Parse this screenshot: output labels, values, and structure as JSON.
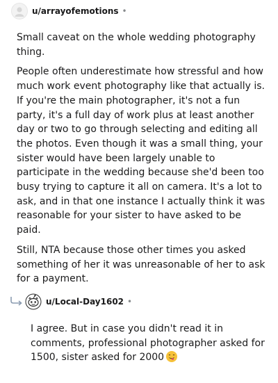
{
  "comments": [
    {
      "username": "u/arrayofemotions",
      "separator": "•",
      "paragraphs": [
        "Small caveat on the whole wedding photography thing.",
        "People often underestimate how stressful and how much work event photography like that actually is. If you're the main photographer, it's not a fun party, it's a full day of work plus at least another day or two to go through selecting and editing all the photos. Even though it was a small thing, your sister would have been largely unable to participate in the wedding because she'd been too busy trying to capture it all on camera. It's a lot to ask, and in that one instance I actually think it was reasonable for your sister to have asked to be paid.",
        "Still, NTA because those other times you asked something of her it was unreasonable of her to ask for a payment."
      ]
    },
    {
      "username": "u/Local-Day1602",
      "separator": "•",
      "text": "I agree. But in case you didn't read it in comments, professional photographer asked for 1500, sister asked for 2000",
      "emoji": "grinning-tongue-emoji"
    }
  ]
}
